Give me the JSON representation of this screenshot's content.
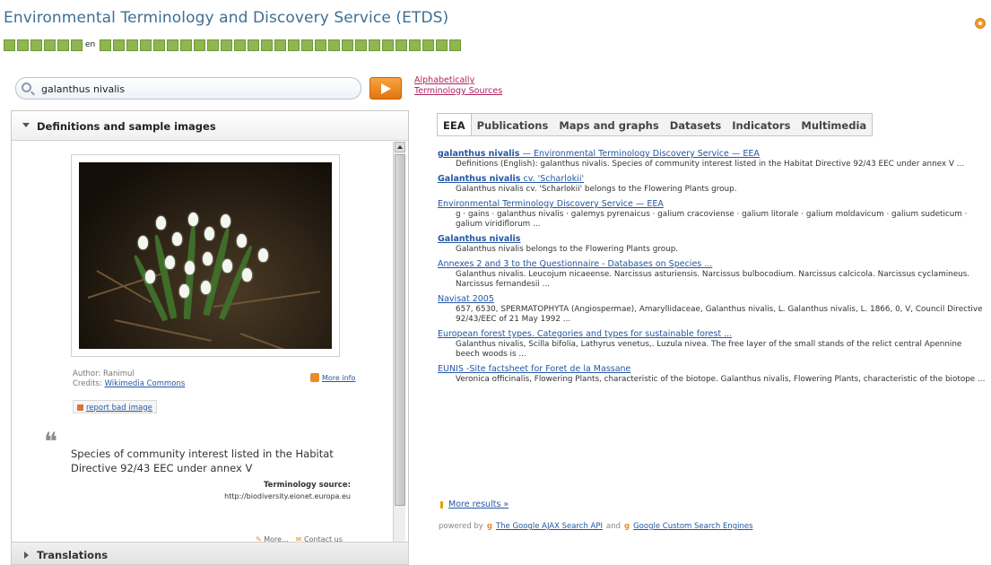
{
  "header": {
    "title": "Environmental Terminology and Discovery Service (ETDS)",
    "current_language": "en"
  },
  "search": {
    "value": "galanthus nivalis",
    "placeholder": ""
  },
  "top_links": {
    "alphabetically": "Alphabetically",
    "terminology_sources": "Terminology Sources"
  },
  "left_panel": {
    "title": "Definitions and sample images",
    "image_author": "Author: Ranimul",
    "credits_label": "Credits: ",
    "credits_link": "Wikimedia Commons",
    "more_info": "More info",
    "report_bad_image": "report bad image",
    "definition": "Species of community interest listed in the Habitat Directive 92/43 EEC under annex V",
    "terminology_source_label": "Terminology source:",
    "terminology_source_url": "http://biodiversity.eionet.europa.eu",
    "bottom_more": "More...",
    "bottom_contact": "Contact us",
    "translations_title": "Translations"
  },
  "tabs": [
    {
      "label": "EEA"
    },
    {
      "label": "Publications"
    },
    {
      "label": "Maps and graphs"
    },
    {
      "label": "Datasets"
    },
    {
      "label": "Indicators"
    },
    {
      "label": "Multimedia"
    }
  ],
  "results": [
    {
      "title_bold": "galanthus nivalis",
      "title_rest": " — Environmental Terminology Discovery Service — EEA",
      "snippet": "Definitions (English): galanthus nivalis. Species of community interest listed in the Habitat Directive 92/43 EEC under annex V ..."
    },
    {
      "title_bold": "Galanthus nivalis",
      "title_rest": " cv. 'Scharlokii'",
      "snippet": "Galanthus nivalis cv. 'Scharlokii' belongs to the Flowering Plants group."
    },
    {
      "title_bold": "",
      "title_rest": "Environmental Terminology Discovery Service — EEA",
      "snippet": "g · gains · galanthus nivalis · galemys pyrenaicus · galium cracoviense · galium litorale · galium moldavicum · galium sudeticum · galium viridiflorum ..."
    },
    {
      "title_bold": "Galanthus nivalis",
      "title_rest": "",
      "snippet": "Galanthus nivalis belongs to the Flowering Plants group."
    },
    {
      "title_bold": "",
      "title_rest": "Annexes 2 and 3 to the Questionnaire - Databases on Species ...",
      "snippet": "Galanthus nivalis. Leucojum nicaeense. Narcissus asturiensis. Narcissus bulbocodium. Narcissus calcicola. Narcissus cyclamineus. Narcissus fernandesii ..."
    },
    {
      "title_bold": "",
      "title_rest": "Navisat 2005",
      "snippet": "657, 6530, SPERMATOPHYTA (Angiospermae), Amaryllidaceae, Galanthus nivalis, L. Galanthus nivalis, L. 1866, 0, V, Council Directive 92/43/EEC of 21 May 1992 ..."
    },
    {
      "title_bold": "",
      "title_rest": "European forest types. Categories and types for sustainable forest ...",
      "snippet": "Galanthus nivalis, Scilla bifolia, Lathyrus venetus,. Luzula nivea. The free layer of the small stands of the relict central Apennine beech woods is ..."
    },
    {
      "title_bold": "",
      "title_rest": "EUNIS -Site factsheet for Foret de la Massane",
      "snippet": "Veronica officinalis, Flowering Plants, characteristic of the biotope. Galanthus nivalis, Flowering Plants, characteristic of the biotope ..."
    }
  ],
  "more_results": "More results »",
  "powered_by": {
    "prefix": "powered by",
    "link1": "The Google AJAX Search API",
    "and": "and",
    "link2": "Google Custom Search Engines"
  },
  "icons": {
    "search": "search-icon",
    "go": "arrow-right-icon",
    "rss": "rss-icon"
  },
  "colors": {
    "title": "#3d6f95",
    "link": "#2457a5",
    "accent_orange": "#e27410",
    "language_green": "#8fb64f"
  }
}
